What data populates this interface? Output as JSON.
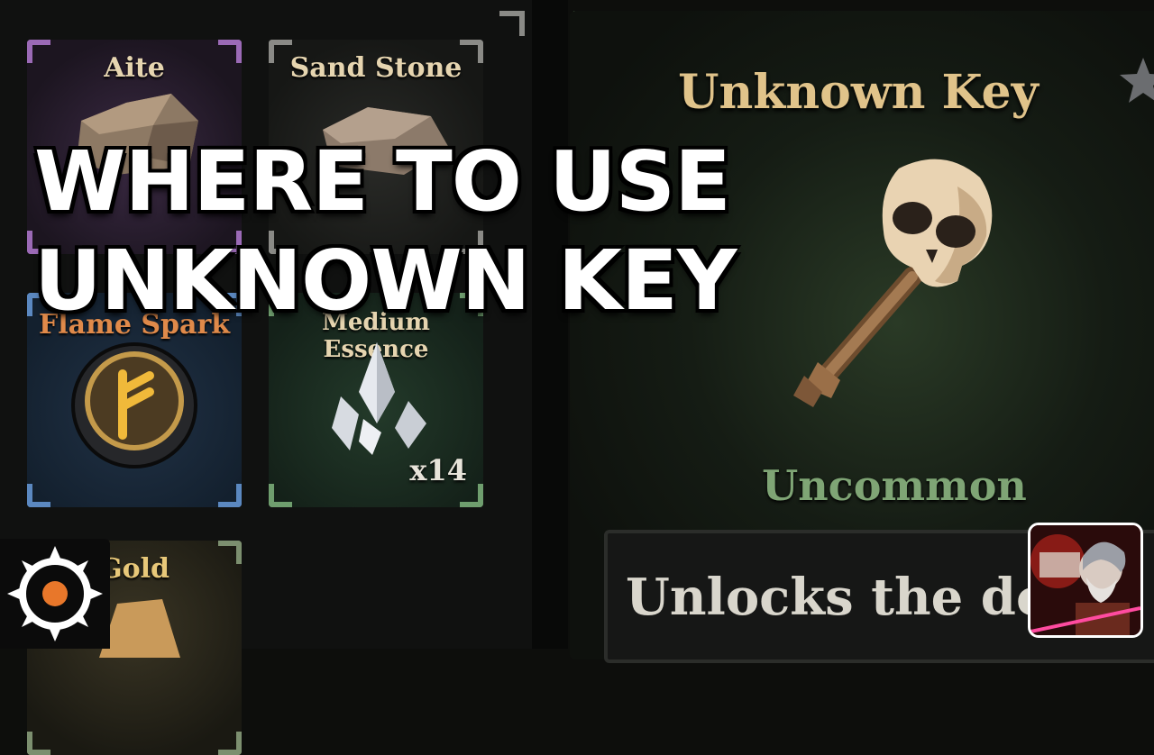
{
  "headline": {
    "line1": "WHERE TO USE",
    "line2": "UNKNOWN KEY"
  },
  "inventory": {
    "slots": [
      {
        "name": "Aite",
        "color": "#9b6ab6"
      },
      {
        "name": "Sand Stone",
        "color": "#8a8a86"
      },
      {
        "name": "Flame Spark",
        "color": "#5b88c0"
      },
      {
        "name": "Medium Essence",
        "color": "#6f9e6e",
        "count": "x14"
      },
      {
        "name": "Gold",
        "color": "#7c8f6f"
      }
    ]
  },
  "item_detail": {
    "name": "Unknown Key",
    "rarity": "Uncommon",
    "rarity_color": "#7fa575",
    "description": "Unlocks the do"
  },
  "icons": [
    "favorite-star-icon",
    "skull-key-icon",
    "channel-logo-icon",
    "character-avatar"
  ]
}
